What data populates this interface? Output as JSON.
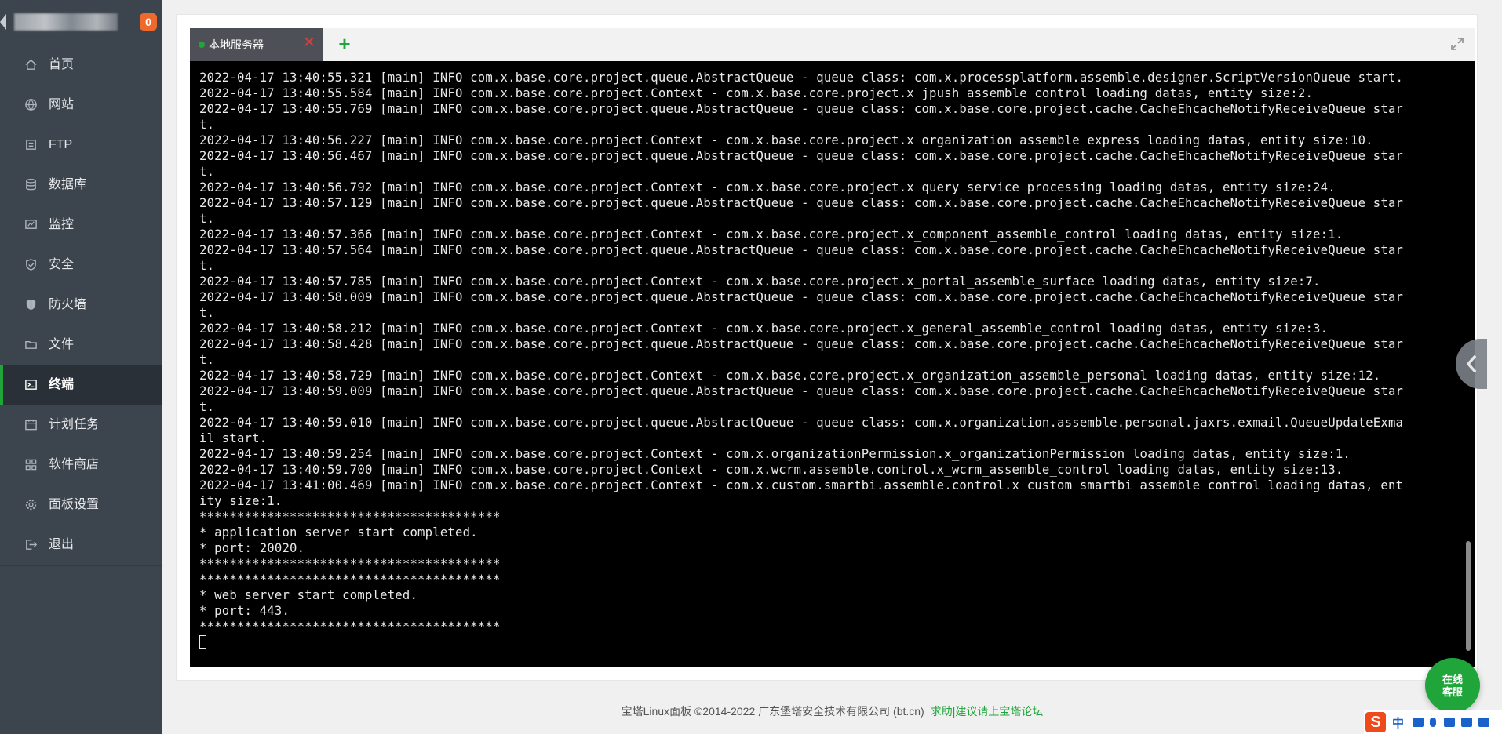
{
  "sidebar": {
    "badge": "0",
    "items": [
      {
        "label": "首页",
        "icon": "home-icon"
      },
      {
        "label": "网站",
        "icon": "globe-icon"
      },
      {
        "label": "FTP",
        "icon": "ftp-icon"
      },
      {
        "label": "数据库",
        "icon": "database-icon"
      },
      {
        "label": "监控",
        "icon": "monitor-icon"
      },
      {
        "label": "安全",
        "icon": "shield-check-icon"
      },
      {
        "label": "防火墙",
        "icon": "firewall-shield-icon"
      },
      {
        "label": "文件",
        "icon": "folder-icon"
      },
      {
        "label": "终端",
        "icon": "terminal-icon",
        "active": true
      },
      {
        "label": "计划任务",
        "icon": "calendar-icon"
      },
      {
        "label": "软件商店",
        "icon": "apps-grid-icon"
      },
      {
        "label": "面板设置",
        "icon": "gear-icon"
      },
      {
        "label": "退出",
        "icon": "logout-icon"
      }
    ]
  },
  "terminal": {
    "tab_title": "本地服务器",
    "tab_close_glyph": "✕",
    "add_glyph": "+",
    "lines": [
      "2022-04-17 13:40:55.321 [main] INFO com.x.base.core.project.queue.AbstractQueue - queue class: com.x.processplatform.assemble.designer.ScriptVersionQueue start.",
      "2022-04-17 13:40:55.584 [main] INFO com.x.base.core.project.Context - com.x.base.core.project.x_jpush_assemble_control loading datas, entity size:2.",
      "2022-04-17 13:40:55.769 [main] INFO com.x.base.core.project.queue.AbstractQueue - queue class: com.x.base.core.project.cache.CacheEhcacheNotifyReceiveQueue star",
      "t.",
      "2022-04-17 13:40:56.227 [main] INFO com.x.base.core.project.Context - com.x.base.core.project.x_organization_assemble_express loading datas, entity size:10.",
      "2022-04-17 13:40:56.467 [main] INFO com.x.base.core.project.queue.AbstractQueue - queue class: com.x.base.core.project.cache.CacheEhcacheNotifyReceiveQueue star",
      "t.",
      "2022-04-17 13:40:56.792 [main] INFO com.x.base.core.project.Context - com.x.base.core.project.x_query_service_processing loading datas, entity size:24.",
      "2022-04-17 13:40:57.129 [main] INFO com.x.base.core.project.queue.AbstractQueue - queue class: com.x.base.core.project.cache.CacheEhcacheNotifyReceiveQueue star",
      "t.",
      "2022-04-17 13:40:57.366 [main] INFO com.x.base.core.project.Context - com.x.base.core.project.x_component_assemble_control loading datas, entity size:1.",
      "2022-04-17 13:40:57.564 [main] INFO com.x.base.core.project.queue.AbstractQueue - queue class: com.x.base.core.project.cache.CacheEhcacheNotifyReceiveQueue star",
      "t.",
      "2022-04-17 13:40:57.785 [main] INFO com.x.base.core.project.Context - com.x.base.core.project.x_portal_assemble_surface loading datas, entity size:7.",
      "2022-04-17 13:40:58.009 [main] INFO com.x.base.core.project.queue.AbstractQueue - queue class: com.x.base.core.project.cache.CacheEhcacheNotifyReceiveQueue star",
      "t.",
      "2022-04-17 13:40:58.212 [main] INFO com.x.base.core.project.Context - com.x.base.core.project.x_general_assemble_control loading datas, entity size:3.",
      "2022-04-17 13:40:58.428 [main] INFO com.x.base.core.project.queue.AbstractQueue - queue class: com.x.base.core.project.cache.CacheEhcacheNotifyReceiveQueue star",
      "t.",
      "2022-04-17 13:40:58.729 [main] INFO com.x.base.core.project.Context - com.x.base.core.project.x_organization_assemble_personal loading datas, entity size:12.",
      "2022-04-17 13:40:59.009 [main] INFO com.x.base.core.project.queue.AbstractQueue - queue class: com.x.base.core.project.cache.CacheEhcacheNotifyReceiveQueue star",
      "t.",
      "2022-04-17 13:40:59.010 [main] INFO com.x.base.core.project.queue.AbstractQueue - queue class: com.x.organization.assemble.personal.jaxrs.exmail.QueueUpdateExma",
      "il start.",
      "2022-04-17 13:40:59.254 [main] INFO com.x.base.core.project.Context - com.x.organizationPermission.x_organizationPermission loading datas, entity size:1.",
      "2022-04-17 13:40:59.700 [main] INFO com.x.base.core.project.Context - com.x.wcrm.assemble.control.x_wcrm_assemble_control loading datas, entity size:13.",
      "2022-04-17 13:41:00.469 [main] INFO com.x.base.core.project.Context - com.x.custom.smartbi.assemble.control.x_custom_smartbi_assemble_control loading datas, ent",
      "ity size:1.",
      "****************************************",
      "* application server start completed.",
      "* port: 20020.",
      "****************************************",
      "****************************************",
      "* web server start completed.",
      "* port: 443.",
      "****************************************"
    ]
  },
  "footer": {
    "copyright": "宝塔Linux面板 ©2014-2022 广东堡塔安全技术有限公司 (bt.cn)",
    "link": "求助|建议请上宝塔论坛"
  },
  "support": {
    "label": "在线\n客服"
  },
  "ime": {
    "logo": "S",
    "mode": "中"
  },
  "colors": {
    "accent": "#20a53a",
    "sidebar_bg": "#3c444d",
    "badge": "#f0692c",
    "close": "#e03c3c"
  }
}
